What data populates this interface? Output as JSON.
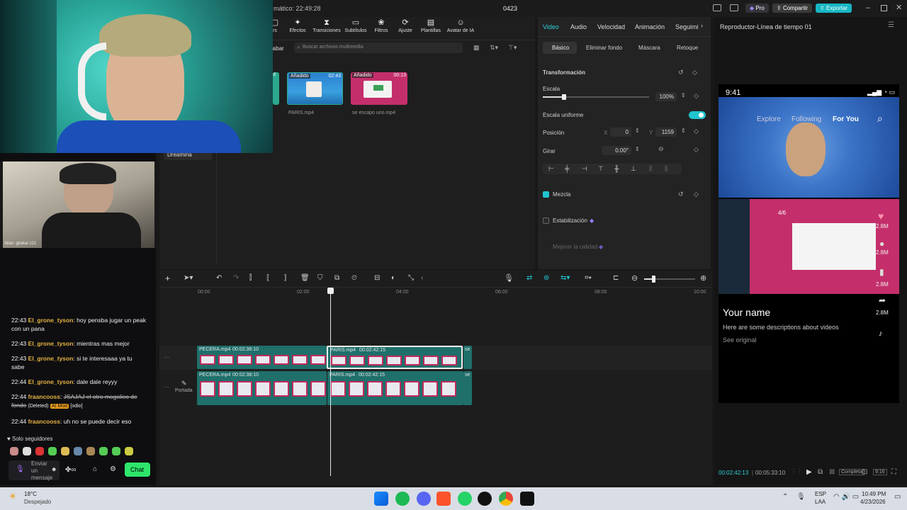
{
  "titlebar": {
    "autosave_label": "mático: 22:49:28",
    "project_name": "0423",
    "pro_label": "Pro",
    "share_label": "Compartir",
    "export_label": "Exportar"
  },
  "media_toolbar": [
    {
      "label": "rs",
      "icon": "folder-icon"
    },
    {
      "label": "Efectos",
      "icon": "sparkle-icon"
    },
    {
      "label": "Transiciones",
      "icon": "hourglass-icon"
    },
    {
      "label": "Subtítulos",
      "icon": "caption-icon"
    },
    {
      "label": "Filtros",
      "icon": "filters-icon"
    },
    {
      "label": "Ajuste",
      "icon": "adjust-icon"
    },
    {
      "label": "Plantillas",
      "icon": "templates-icon"
    },
    {
      "label": "Avatar de IA",
      "icon": "avatar-icon"
    }
  ],
  "media": {
    "record_label": "rabar",
    "search_placeholder": "Buscar archivos multimedia",
    "sidebar_item": "Dreamina",
    "items": [
      {
        "badge": "Añadido",
        "duration": "02:43",
        "name": "PARIS.mp4"
      },
      {
        "badge": "Añadido",
        "duration": "00:13",
        "name": "se escapo uno.mp4"
      }
    ],
    "partial_duration": "9"
  },
  "props": {
    "tabs": [
      "Video",
      "Audio",
      "Velocidad",
      "Animación",
      "Seguimi"
    ],
    "subtabs": [
      "Básico",
      "Eliminar fondo",
      "Máscara",
      "Retoque"
    ],
    "transform_label": "Transformación",
    "scale_label": "Escala",
    "scale_value": "100%",
    "uniform_scale_label": "Escala uniforme",
    "position_label": "Posición",
    "pos_x_label": "X",
    "pos_x": "0",
    "pos_y_label": "Y",
    "pos_y": "1159",
    "rotate_label": "Girar",
    "rotate_value": "0.00°",
    "blend_label": "Mezcla",
    "stabilize_label": "Estabilización",
    "enhance_label": "Mejorar la calidad"
  },
  "player": {
    "title": "Reproductor-Línea de tiempo 01",
    "phone_time": "9:41",
    "nav_explore": "Explore",
    "nav_following": "Following",
    "nav_foryou": "For You",
    "page_indicator": "4/6",
    "like_count": "2.8M",
    "comment_count": "2.8M",
    "save_count": "2.8M",
    "share_count": "2.8M",
    "your_name": "Your name",
    "description": "Here are some descriptions about videos",
    "see_original": "See original",
    "current_time": "00:02:42:13",
    "total_time": "00:05:33:10",
    "fit_label": "Completa"
  },
  "timeline": {
    "ruler": [
      "00:00",
      "02:00",
      "04:00",
      "06:00",
      "08:00",
      "10:00"
    ],
    "cover_label": "Portada",
    "clips_top": [
      {
        "name": "PECERA.mp4",
        "duration": "00:02:38:10"
      },
      {
        "name": "PARIS.mp4",
        "duration": "00:02:42:15"
      },
      {
        "name": "se",
        "duration": ""
      }
    ],
    "clips_bottom": [
      {
        "name": "PECERA.mp4",
        "duration": "00:02:38:10"
      },
      {
        "name": "PARIS.mp4",
        "duration": "00:02:42:15"
      },
      {
        "name": "se",
        "duration": ""
      }
    ]
  },
  "webcam": {
    "alias": "Alias: gkakal 121"
  },
  "chat": {
    "messages": [
      {
        "time": "22:43",
        "user": "El_grone_tyson",
        "text": "hoy pensba jugar un peak con un pana"
      },
      {
        "time": "22:43",
        "user": "El_grone_tyson",
        "text": "mientras mas mejor"
      },
      {
        "time": "22:43",
        "user": "El_grone_tyson",
        "text": "si te interesaaa ya tu sabe"
      },
      {
        "time": "22:44",
        "user": "El_grone_tyson",
        "text": "dale dale reyyy"
      },
      {
        "time": "22:44",
        "user": "fraancooss",
        "text": "JSAJAJ el otro mogolico de fondo",
        "deleted": "(Deleted)",
        "mod_tag": "AI Mod",
        "reason": "[odio]"
      },
      {
        "time": "22:44",
        "user": "fraancooss",
        "text": "uh no se puede decir eso"
      }
    ],
    "followers_only": "Solo seguidores",
    "input_placeholder": "Enviar un mensaje",
    "chat_button": "Chat"
  },
  "taskbar": {
    "temp": "18°C",
    "weather": "Despejado",
    "lang": "ESP",
    "lang2": "LAA",
    "time": "10:49 PM",
    "date": "4/23/2026"
  }
}
